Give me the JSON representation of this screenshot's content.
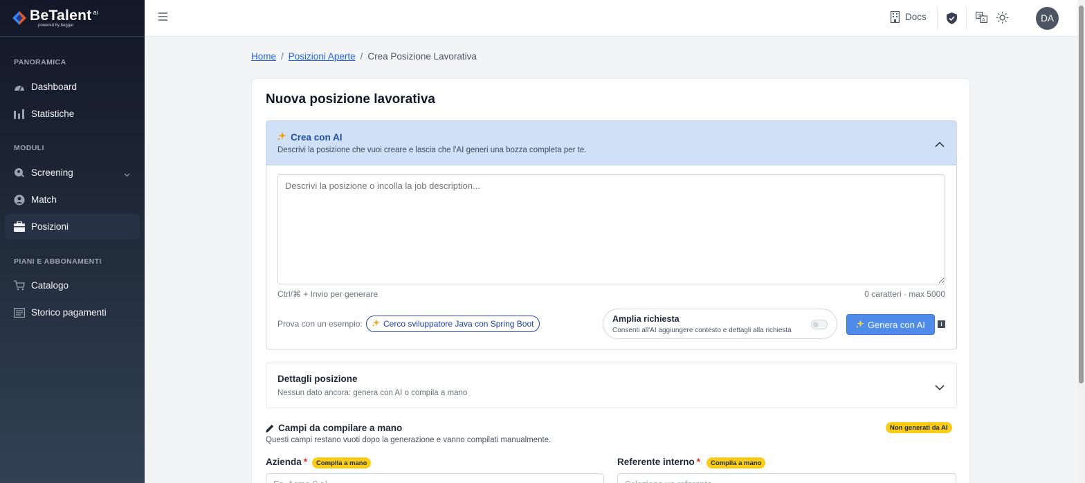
{
  "brand": {
    "name": "BeTalent",
    "superscript": "ai",
    "tagline": "powered by beggar"
  },
  "sidebar": {
    "sections": [
      {
        "title": "PANORAMICA"
      },
      {
        "title": "MODULI"
      },
      {
        "title": "PIANI E ABBONAMENTI"
      }
    ],
    "items": [
      {
        "label": "Dashboard",
        "icon": "gauge-icon"
      },
      {
        "label": "Statistiche",
        "icon": "bar-chart-icon"
      },
      {
        "label": "Screening",
        "icon": "search-person-icon"
      },
      {
        "label": "Match",
        "icon": "user-circle-icon"
      },
      {
        "label": "Posizioni",
        "icon": "briefcase-icon",
        "active": true
      },
      {
        "label": "Catalogo",
        "icon": "cart-icon"
      },
      {
        "label": "Storico pagamenti",
        "icon": "receipt-icon"
      }
    ]
  },
  "topbar": {
    "docs_label": "Docs",
    "avatar_initials": "DA"
  },
  "breadcrumb": {
    "home": "Home",
    "positions": "Posizioni Aperte",
    "current": "Crea Posizione Lavorativa",
    "separator": "/"
  },
  "page": {
    "title": "Nuova posizione lavorativa"
  },
  "ai_panel": {
    "title": "Crea con AI",
    "description": "Descrivi la posizione che vuoi creare e lascia che l'AI generi una bozza completa per te.",
    "textarea_placeholder": "Descrivi la posizione o incolla la job description...",
    "shortcut_hint": "Ctrl/⌘ + Invio per generare",
    "char_counter": "0 caratteri · max 5000",
    "try_label": "Prova con un esempio:",
    "example_chip": "Cerco sviluppatore Java con Spring Boot",
    "amplia_title": "Amplia richiesta",
    "amplia_desc": "Consenti all'AI aggiungere contesto e dettagli alla richiesta",
    "amplia_enabled": false,
    "generate_button": "Genera con AI",
    "info_icon": "i",
    "colors": {
      "header_bg": "#cfe0f7",
      "title": "#1e4fa3",
      "button": "#4f8be9"
    }
  },
  "details_panel": {
    "title": "Dettagli posizione",
    "subtitle": "Nessun dato ancora: genera con AI o compila a mano"
  },
  "manual_section": {
    "title": "Campi da compilare a mano",
    "description": "Questi campi restano vuoti dopo la generazione e vanno compilati manualmente.",
    "badge": "Non generati da AI",
    "fields": [
      {
        "label": "Azienda",
        "required_mark": "*",
        "badge": "Compila a mano",
        "placeholder": "Es. Acme S.r.l."
      },
      {
        "label": "Referente interno",
        "required_mark": "*",
        "badge": "Compila a mano",
        "placeholder": "Seleziona un referente"
      }
    ]
  }
}
